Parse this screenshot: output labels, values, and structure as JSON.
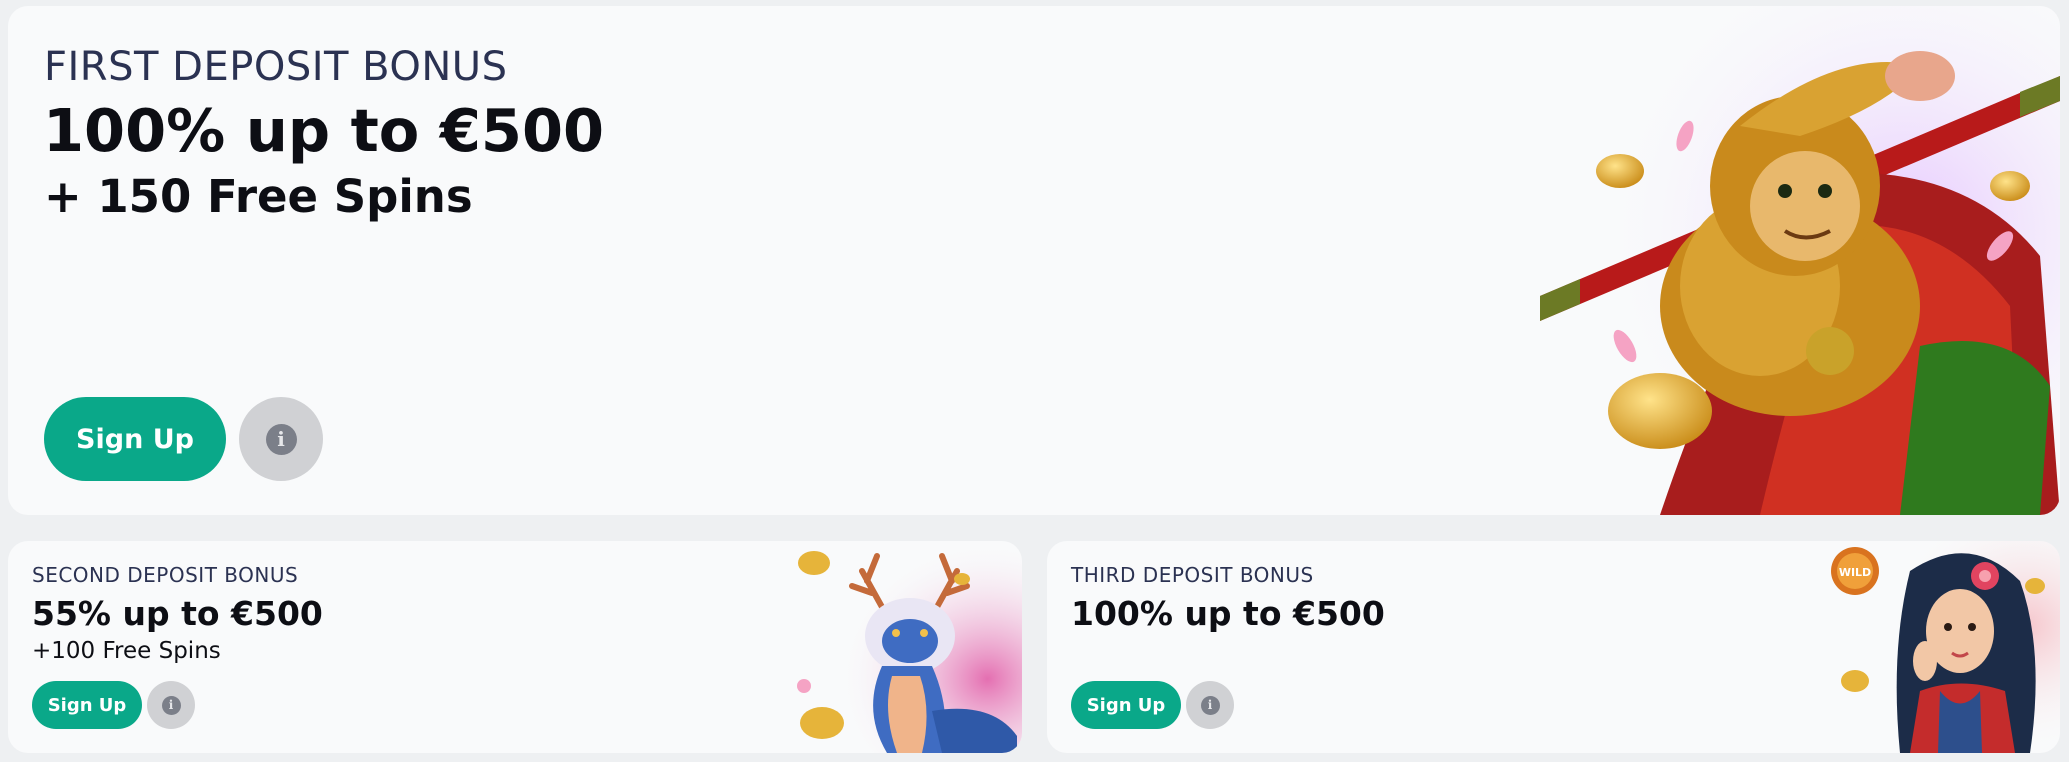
{
  "first": {
    "eyebrow": "FIRST DEPOSIT BONUS",
    "headline": "100% up to €500",
    "sub": "+ 150 Free Spins",
    "signup_label": "Sign Up",
    "info_glyph": "i",
    "illustration_icon": "monkey-king-illustration"
  },
  "second": {
    "eyebrow": "SECOND DEPOSIT BONUS",
    "headline": "55% up to €500",
    "sub": "+100 Free Spins",
    "signup_label": "Sign Up",
    "info_glyph": "i",
    "illustration_icon": "dragon-illustration"
  },
  "third": {
    "eyebrow": "THIRD DEPOSIT BONUS",
    "headline": "100% up to €500",
    "signup_label": "Sign Up",
    "info_glyph": "i",
    "illustration_icon": "woman-illustration",
    "wild_badge": "WILD"
  },
  "colors": {
    "accent": "#0aa889",
    "card_bg": "#f9fafb",
    "page_bg": "#eef0f2",
    "eyebrow_text": "#2b3252",
    "headline_text": "#0d0e14",
    "info_bg": "#d0d1d4"
  }
}
